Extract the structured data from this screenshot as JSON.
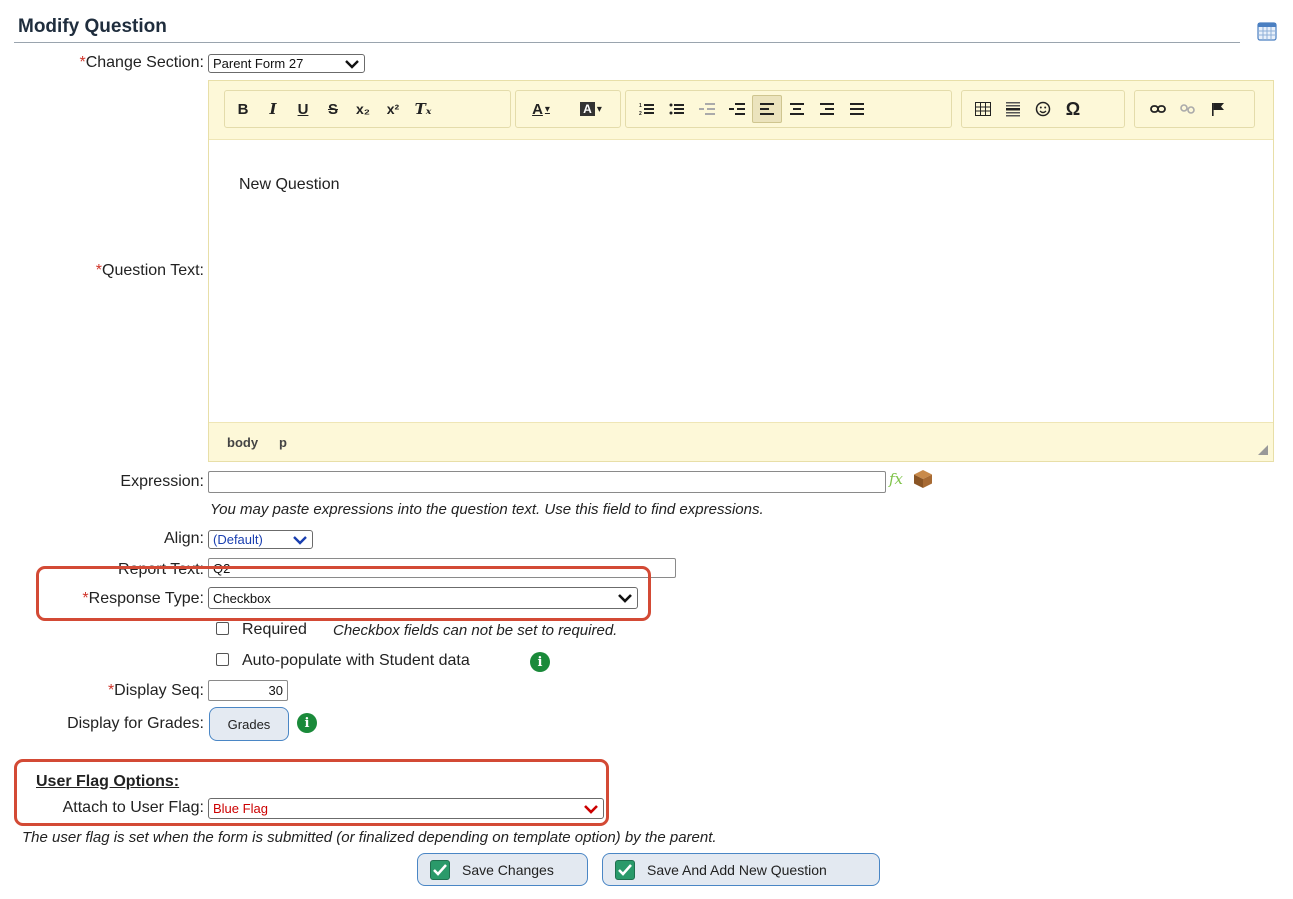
{
  "page": {
    "title": "Modify Question",
    "calendar_icon": "calendar-icon"
  },
  "change_section": {
    "label": "Change Section:",
    "value": "Parent Form 27"
  },
  "question_text": {
    "label": "Question Text:",
    "content": "New Question",
    "statusbar": [
      "body",
      "p"
    ],
    "toolbar": {
      "bold": "B",
      "italic": "I",
      "underline": "U",
      "strike": "S",
      "subscript": "x₂",
      "superscript": "x²",
      "remove_format": "Tₓ",
      "text_color": "A",
      "bg_color": "A",
      "special_char": "Ω"
    }
  },
  "expression": {
    "label": "Expression:",
    "value": "",
    "hint": "You may paste expressions into the question text. Use this field to find expressions."
  },
  "align": {
    "label": "Align:",
    "value": "(Default)"
  },
  "report_text": {
    "label": "Report Text:",
    "value": "Q2"
  },
  "response_type": {
    "label": "Response Type:",
    "value": "Checkbox"
  },
  "required": {
    "label": "Required",
    "hint": "Checkbox fields can not be set to required."
  },
  "auto_populate": {
    "label": "Auto-populate with Student data"
  },
  "display_seq": {
    "label": "Display Seq:",
    "value": "30"
  },
  "display_for_grades": {
    "label": "Display for Grades:",
    "button": "Grades"
  },
  "user_flag": {
    "title": "User Flag Options:",
    "label": "Attach to User Flag:",
    "value": "Blue Flag",
    "hint": "The user flag is set when the form is submitted (or finalized depending on template option) by the parent."
  },
  "actions": {
    "save": "Save Changes",
    "save_add": "Save And Add New Question"
  },
  "colors": {
    "required_star": "#d0352a",
    "highlight": "#d34a35",
    "flag_text": "#cc0000",
    "align_text": "#1a3fb0"
  }
}
